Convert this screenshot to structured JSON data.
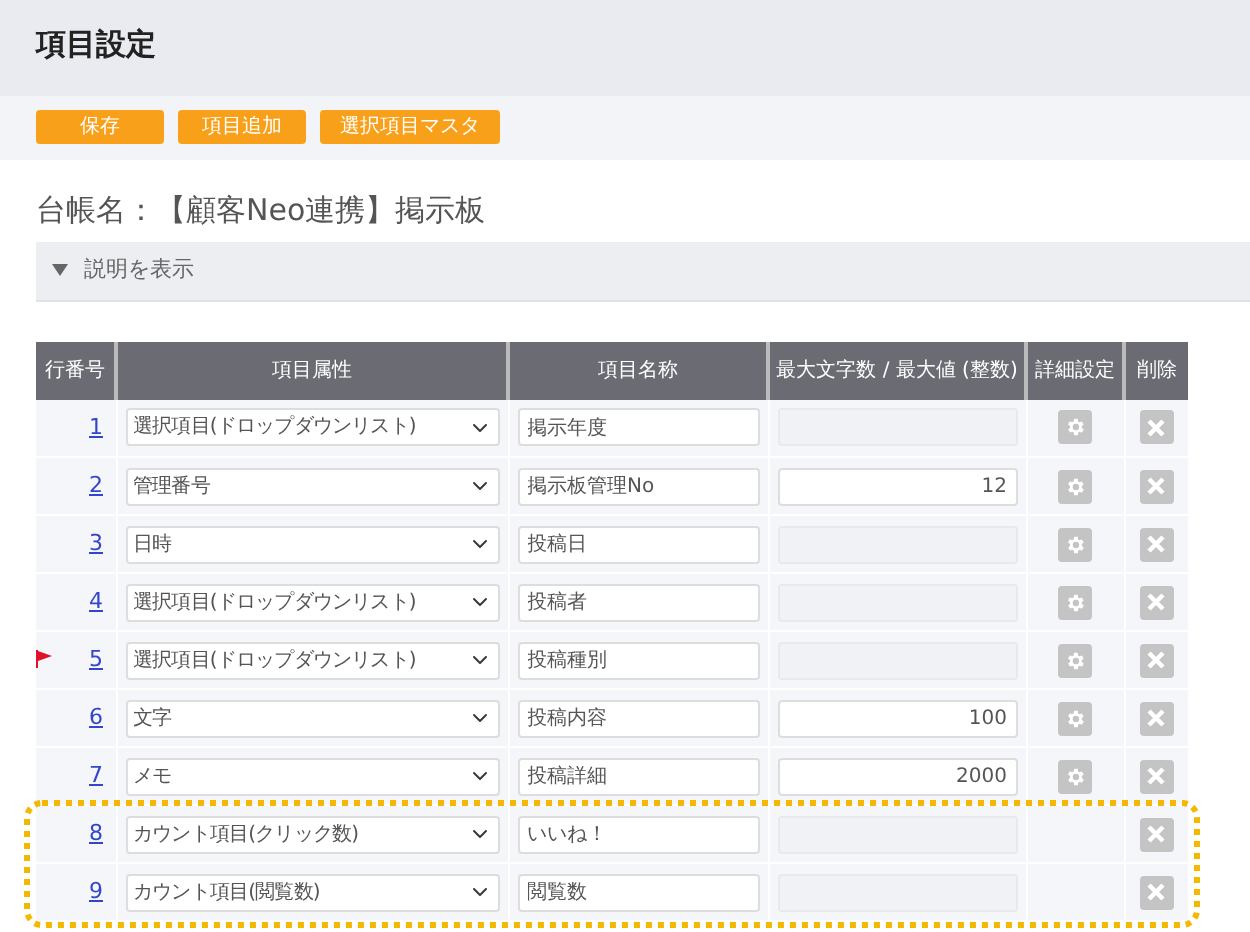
{
  "page_title": "項目設定",
  "toolbar_buttons": [
    "保存",
    "項目追加",
    "選択項目マスタ"
  ],
  "ledger_label": "台帳名：【顧客Neo連携】掲示板",
  "description_toggle": {
    "label": "説明を表示",
    "expanded": false
  },
  "table": {
    "columns": [
      "行番号",
      "項目属性",
      "項目名称",
      "最大文字数 / 最大値 (整数)",
      "詳細設定",
      "削除"
    ],
    "rows": [
      {
        "number": "1",
        "attribute": "選択項目(ドロップダウンリスト)",
        "name": "掲示年度",
        "max_value": null,
        "max_disabled": true,
        "settings": true,
        "flagged": false,
        "highlighted": false
      },
      {
        "number": "2",
        "attribute": "管理番号",
        "name": "掲示板管理No",
        "max_value": "12",
        "max_disabled": false,
        "settings": true,
        "flagged": false,
        "highlighted": false
      },
      {
        "number": "3",
        "attribute": "日時",
        "name": "投稿日",
        "max_value": null,
        "max_disabled": true,
        "settings": true,
        "flagged": false,
        "highlighted": false
      },
      {
        "number": "4",
        "attribute": "選択項目(ドロップダウンリスト)",
        "name": "投稿者",
        "max_value": null,
        "max_disabled": true,
        "settings": true,
        "flagged": false,
        "highlighted": false
      },
      {
        "number": "5",
        "attribute": "選択項目(ドロップダウンリスト)",
        "name": "投稿種別",
        "max_value": null,
        "max_disabled": true,
        "settings": true,
        "flagged": true,
        "highlighted": false
      },
      {
        "number": "6",
        "attribute": "文字",
        "name": "投稿内容",
        "max_value": "100",
        "max_disabled": false,
        "settings": true,
        "flagged": false,
        "highlighted": false
      },
      {
        "number": "7",
        "attribute": "メモ",
        "name": "投稿詳細",
        "max_value": "2000",
        "max_disabled": false,
        "settings": true,
        "flagged": false,
        "highlighted": false
      },
      {
        "number": "8",
        "attribute": "カウント項目(クリック数)",
        "name": "いいね！",
        "max_value": null,
        "max_disabled": true,
        "settings": false,
        "flagged": false,
        "highlighted": true
      },
      {
        "number": "9",
        "attribute": "カウント項目(閲覧数)",
        "name": "閲覧数",
        "max_value": null,
        "max_disabled": true,
        "settings": false,
        "flagged": false,
        "highlighted": true
      }
    ]
  }
}
